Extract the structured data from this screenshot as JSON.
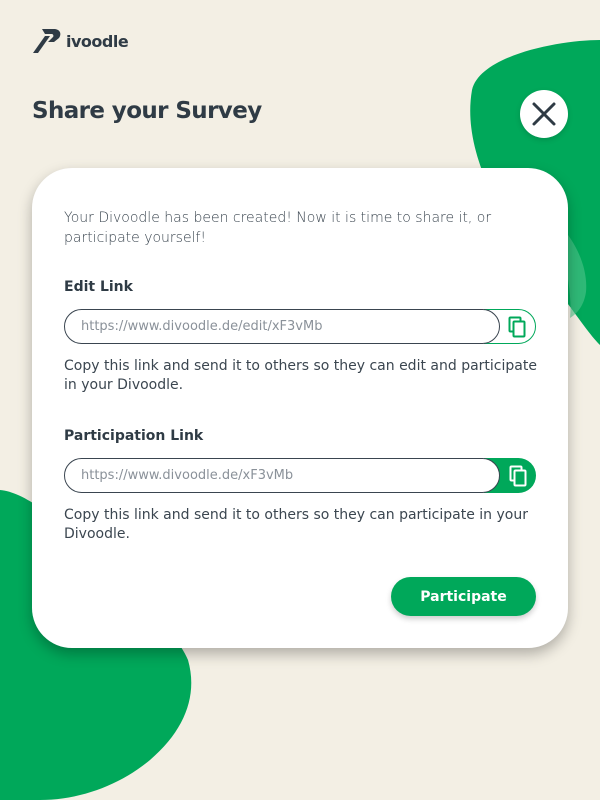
{
  "brand": {
    "name": "ivoodle",
    "logo_icon": "divoodle-logo-icon"
  },
  "page": {
    "title": "Share your Survey"
  },
  "close": {
    "icon": "close-icon"
  },
  "card": {
    "intro": "Your Divoodle has been created! Now it is time to share it, or participate yourself!",
    "edit": {
      "label": "Edit Link",
      "url": "https://www.divoodle.de/edit/xF3vMb",
      "copy_icon": "copy-icon",
      "hint": "Copy this link and send it to others so they can edit and participate in your Divoodle."
    },
    "participation": {
      "label": "Participation Link",
      "url": "https://www.divoodle.de/xF3vMb",
      "copy_icon": "copy-icon",
      "hint": "Copy this link and send it to others so they can participate in your Divoodle."
    },
    "participate_button": "Participate"
  },
  "colors": {
    "background": "#f3efe4",
    "accent_green": "#00a85a",
    "text_dark": "#2f3b45",
    "card": "#ffffff"
  }
}
